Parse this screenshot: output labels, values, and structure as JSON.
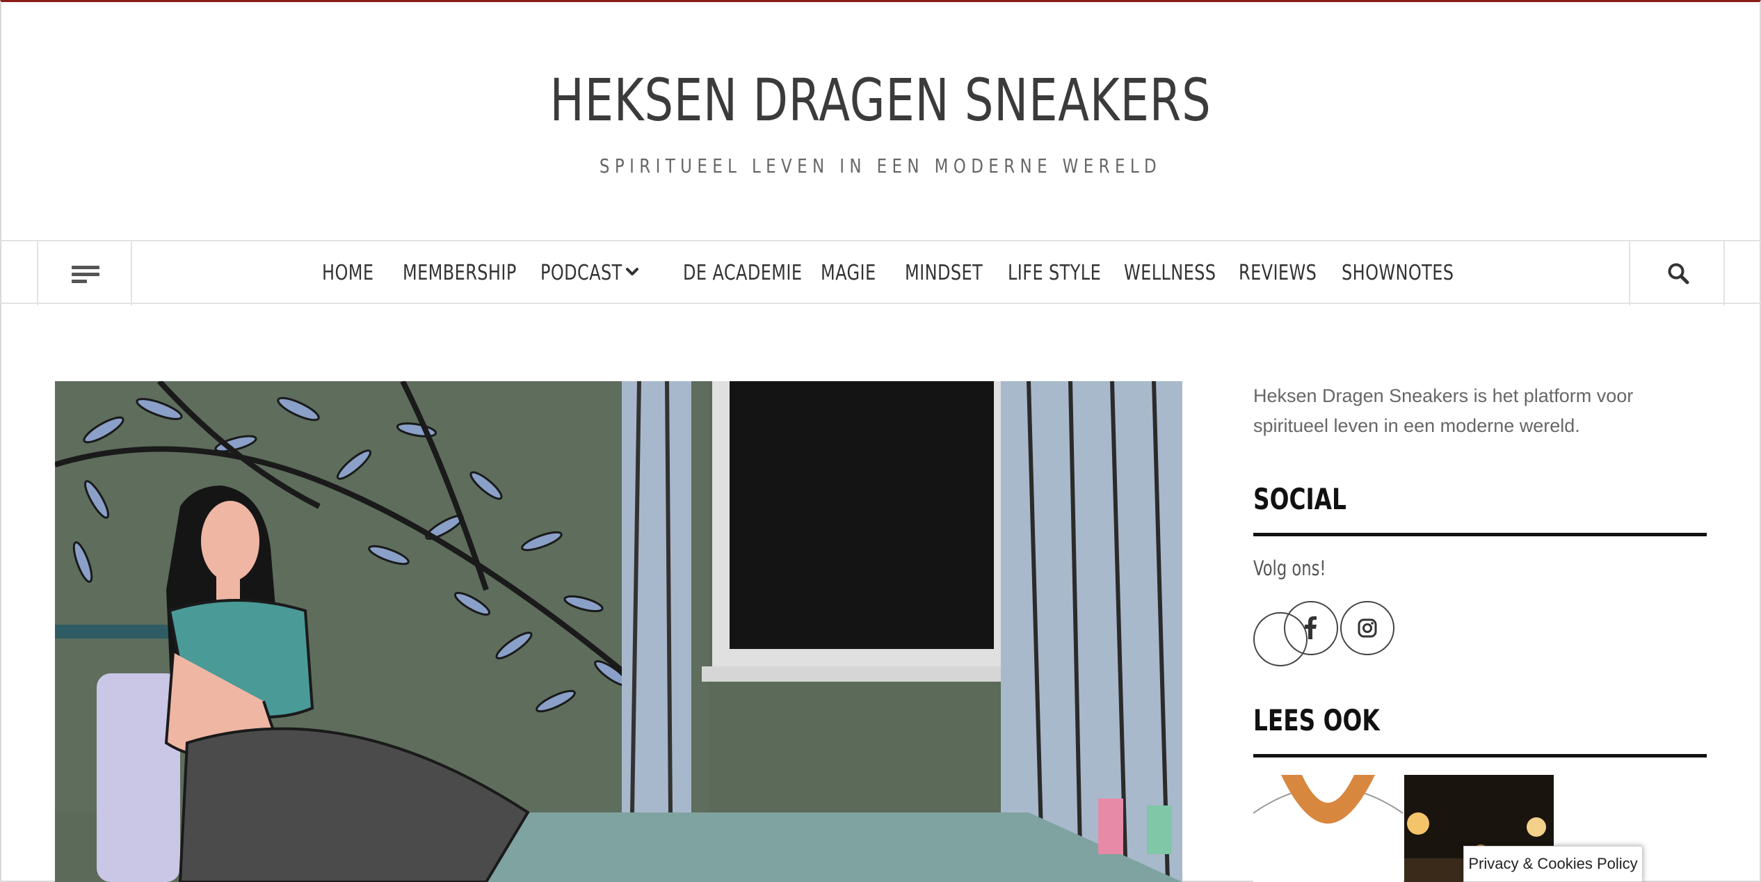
{
  "header": {
    "title": "HEKSEN DRAGEN SNEAKERS",
    "tagline": "SPIRITUEEL LEVEN IN EEN MODERNE WERELD"
  },
  "nav": {
    "items": [
      {
        "label": "HOME"
      },
      {
        "label": "MEMBERSHIP"
      },
      {
        "label": "PODCAST"
      },
      {
        "label": "DE ACADEMIE"
      },
      {
        "label": "MAGIE"
      },
      {
        "label": "MINDSET"
      },
      {
        "label": "LIFE STYLE"
      },
      {
        "label": "WELLNESS"
      },
      {
        "label": "REVIEWS"
      },
      {
        "label": "SHOWNOTES"
      }
    ]
  },
  "sidebar": {
    "about": "Heksen Dragen Sneakers is het platform voor spiritueel leven in een moderne wereld.",
    "social_title": "SOCIAL",
    "social_subtitle": "Volg ons!",
    "related_title": "LEES OOK"
  },
  "icons": {
    "menu": "hamburger-icon",
    "search": "search-icon",
    "dropdown": "chevron-down-icon",
    "social": [
      "facebook-icon",
      "instagram-icon"
    ]
  },
  "colors": {
    "accent_border": "#8b1a1a",
    "text_dark": "#333333",
    "rule": "#111111"
  },
  "cookie": {
    "label": "Privacy & Cookies Policy"
  }
}
